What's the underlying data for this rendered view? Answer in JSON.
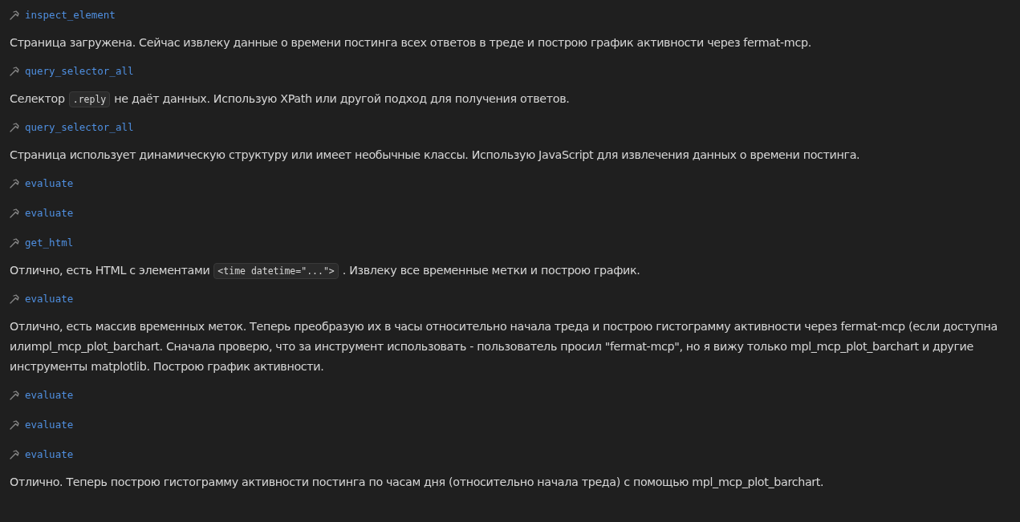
{
  "messages": [
    {
      "kind": "tool",
      "name": "inspect_element"
    },
    {
      "kind": "text",
      "lines": [
        [
          {
            "kind": "plain",
            "text": "Страница загружена. Сейчас извлеку данные о времени постинга всех ответов в треде и построю график активности через fermat-mcp."
          }
        ]
      ]
    },
    {
      "kind": "tool",
      "name": "query_selector_all"
    },
    {
      "kind": "text",
      "lines": [
        [
          {
            "kind": "plain",
            "text": "Селектор"
          },
          {
            "kind": "code",
            "text": ".reply"
          },
          {
            "kind": "plain",
            "text": "не даёт данных. Использую XPath или другой подход для получения ответов."
          }
        ]
      ]
    },
    {
      "kind": "tool",
      "name": "query_selector_all"
    },
    {
      "kind": "text",
      "lines": [
        [
          {
            "kind": "plain",
            "text": "Страница использует динамическую структуру или имеет необычные классы. Использую JavaScript для извлечения данных о времени постинга."
          }
        ]
      ]
    },
    {
      "kind": "tool",
      "name": "evaluate"
    },
    {
      "kind": "tool",
      "name": "evaluate"
    },
    {
      "kind": "tool",
      "name": "get_html"
    },
    {
      "kind": "text",
      "lines": [
        [
          {
            "kind": "plain",
            "text": "Отлично, есть HTML с элементами"
          },
          {
            "kind": "code",
            "text": "<time datetime=\"...\">"
          },
          {
            "kind": "plain",
            "text": ". Извлеку все временные метки и построю график."
          }
        ]
      ]
    },
    {
      "kind": "tool",
      "name": "evaluate"
    },
    {
      "kind": "text",
      "lines": [
        [
          {
            "kind": "plain",
            "text": "Отлично, есть массив временных меток. Теперь преобразую их в часы относительно начала треда и построю гистограмму активности через fermat-mcp (если доступна"
          }
        ],
        [
          {
            "kind": "plain",
            "text": "илиmpl_mcp_plot_barchart. Сначала проверю, что за инструмент использовать - пользователь просил \"fermat-mcp\", но я вижу только mpl_mcp_plot_barchart и другие"
          }
        ],
        [
          {
            "kind": "plain",
            "text": "инструменты matplotlib. Построю график активности."
          }
        ]
      ]
    },
    {
      "kind": "tool",
      "name": "evaluate"
    },
    {
      "kind": "tool",
      "name": "evaluate"
    },
    {
      "kind": "tool",
      "name": "evaluate"
    },
    {
      "kind": "text",
      "lines": [
        [
          {
            "kind": "plain",
            "text": "Отлично. Теперь построю гистограмму активности постинга по часам дня (относительно начала треда) с помощью mpl_mcp_plot_barchart."
          }
        ]
      ]
    }
  ]
}
